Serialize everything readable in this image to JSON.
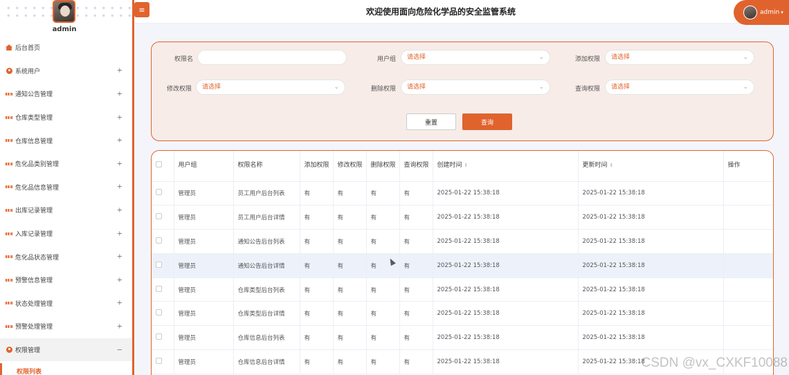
{
  "header": {
    "title": "欢迎使用面向危险化学品的安全监管系统",
    "user": "admin"
  },
  "sidebar": {
    "admin_name": "admin",
    "items": [
      {
        "label": "后台首页",
        "icon": "home-icon"
      },
      {
        "label": "系统用户",
        "icon": "user-icon",
        "toggle": "+"
      },
      {
        "label": "通知公告管理",
        "icon": "grid-icon",
        "toggle": "+"
      },
      {
        "label": "仓库类型管理",
        "icon": "grid-icon",
        "toggle": "+"
      },
      {
        "label": "仓库信息管理",
        "icon": "grid-icon",
        "toggle": "+"
      },
      {
        "label": "危化品类别管理",
        "icon": "grid-icon",
        "toggle": "+"
      },
      {
        "label": "危化品信息管理",
        "icon": "grid-icon",
        "toggle": "+"
      },
      {
        "label": "出库记录管理",
        "icon": "grid-icon",
        "toggle": "+"
      },
      {
        "label": "入库记录管理",
        "icon": "grid-icon",
        "toggle": "+"
      },
      {
        "label": "危化品状态管理",
        "icon": "grid-icon",
        "toggle": "+"
      },
      {
        "label": "预警信息管理",
        "icon": "grid-icon",
        "toggle": "+"
      },
      {
        "label": "状态处理管理",
        "icon": "grid-icon",
        "toggle": "+"
      },
      {
        "label": "预警处理管理",
        "icon": "grid-icon",
        "toggle": "+"
      },
      {
        "label": "权限管理",
        "icon": "user-icon",
        "toggle": "−"
      }
    ],
    "sub_item": "权限列表"
  },
  "search": {
    "labels": {
      "perm_name": "权限名",
      "user_group": "用户组",
      "add": "添加权限",
      "edit": "修改权限",
      "delete": "删除权限",
      "query": "查询权限"
    },
    "placeholder": "请选择",
    "reset": "重置",
    "submit": "查询"
  },
  "table": {
    "headers": [
      "用户组",
      "权限名称",
      "添加权限",
      "修改权限",
      "删除权限",
      "查询权限",
      "创建时间",
      "更新时间",
      "操作"
    ],
    "rows": [
      [
        "管理员",
        "员工用户后台列表",
        "有",
        "有",
        "有",
        "有",
        "2025-01-22 15:38:18",
        "2025-01-22 15:38:18"
      ],
      [
        "管理员",
        "员工用户后台详情",
        "有",
        "有",
        "有",
        "有",
        "2025-01-22 15:38:18",
        "2025-01-22 15:38:18"
      ],
      [
        "管理员",
        "通知公告后台列表",
        "有",
        "有",
        "有",
        "有",
        "2025-01-22 15:38:18",
        "2025-01-22 15:38:18"
      ],
      [
        "管理员",
        "通知公告后台详情",
        "有",
        "有",
        "有",
        "有",
        "2025-01-22 15:38:18",
        "2025-01-22 15:38:18"
      ],
      [
        "管理员",
        "仓库类型后台列表",
        "有",
        "有",
        "有",
        "有",
        "2025-01-22 15:38:18",
        "2025-01-22 15:38:18"
      ],
      [
        "管理员",
        "仓库类型后台详情",
        "有",
        "有",
        "有",
        "有",
        "2025-01-22 15:38:18",
        "2025-01-22 15:38:18"
      ],
      [
        "管理员",
        "仓库信息后台列表",
        "有",
        "有",
        "有",
        "有",
        "2025-01-22 15:38:18",
        "2025-01-22 15:38:18"
      ],
      [
        "管理员",
        "仓库信息后台详情",
        "有",
        "有",
        "有",
        "有",
        "2025-01-22 15:38:18",
        "2025-01-22 15:38:18"
      ]
    ]
  },
  "watermark": "CSDN @vx_CXKF10088",
  "colors": {
    "accent": "#e0632e",
    "panel": "#f7ece8"
  }
}
